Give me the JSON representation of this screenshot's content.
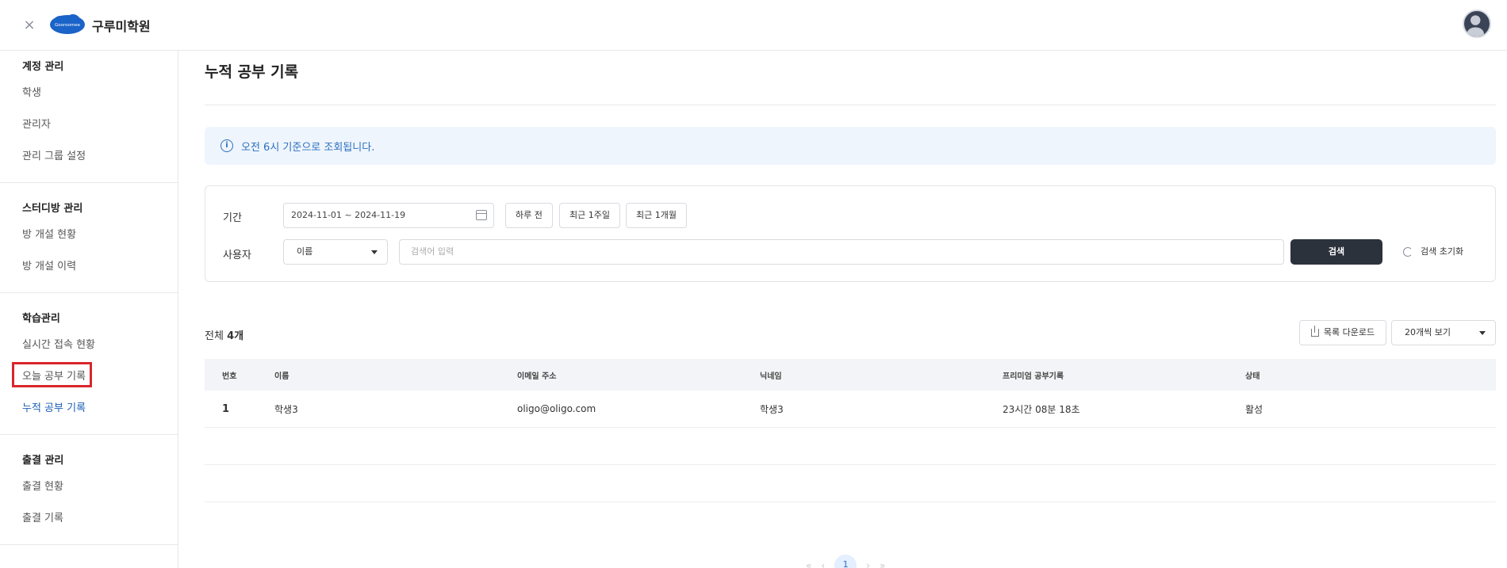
{
  "header": {
    "close_icon": "×",
    "logo_text": "Gooroomee",
    "brand": "구루미학원"
  },
  "sidebar": {
    "groups": [
      {
        "title": "계정 관리",
        "items": [
          "학생",
          "관리자",
          "관리 그룹 설정"
        ]
      },
      {
        "title": "스터디방 관리",
        "items": [
          "방 개설 현황",
          "방 개설 이력"
        ]
      },
      {
        "title": "학습관리",
        "items": [
          "실시간 접속 현황",
          "오늘 공부 기록",
          "누적 공부 기록"
        ]
      },
      {
        "title": "출결 관리",
        "items": [
          "출결 현황",
          "출결 기록"
        ]
      }
    ],
    "active_item": "누적 공부 기록"
  },
  "main": {
    "title": "누적 공부 기록",
    "info": {
      "icon": "i",
      "text": "오전 6시 기준으로 조회됩니다."
    },
    "filter": {
      "period_label": "기간",
      "date_range": "2024-11-01 ~ 2024-11-19",
      "quick_buttons": [
        "하루 전",
        "최근 1주일",
        "최근 1개월"
      ],
      "user_label": "사용자",
      "user_select": "이름",
      "search_placeholder": "검색어 입력",
      "search_button": "검색",
      "reset_button": "검색 초기화"
    },
    "total": {
      "prefix": "전체 ",
      "count": "4개"
    },
    "download_button": "목록 다운로드",
    "page_size": "20개씩 보기",
    "table": {
      "headers": [
        "번호",
        "이름",
        "이메일 주소",
        "닉네임",
        "프리미엄 공부기록",
        "상태"
      ],
      "rows": [
        [
          "1",
          "학생3",
          "oligo@oligo.com",
          "학생3",
          "23시간 08분 18초",
          "활성"
        ]
      ]
    },
    "pagination": {
      "first": "«",
      "prev": "‹",
      "current": "1",
      "next": "›",
      "last": "»"
    }
  }
}
